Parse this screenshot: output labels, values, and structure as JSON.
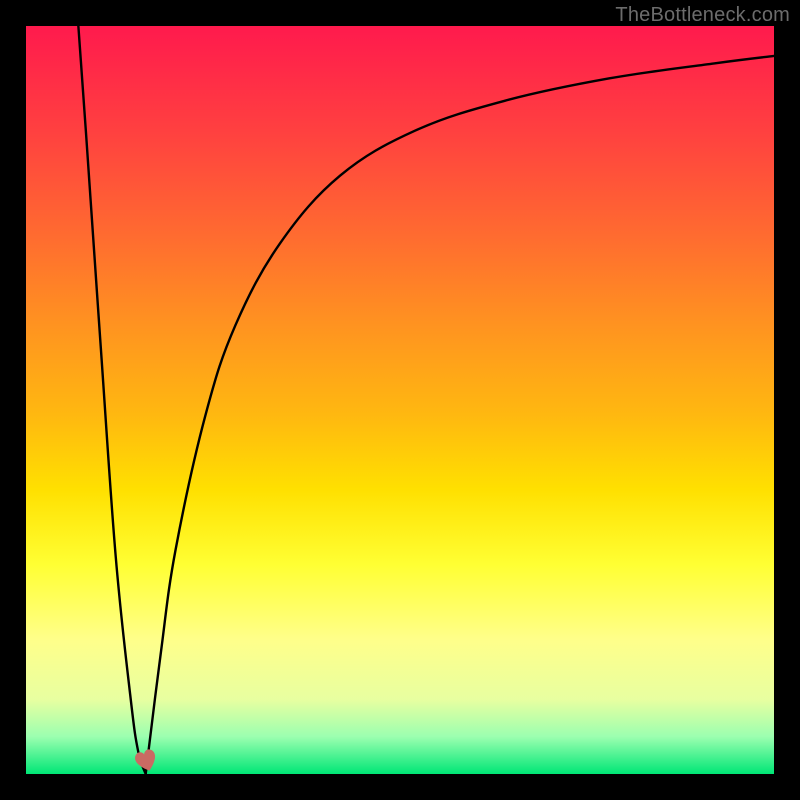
{
  "watermark": "TheBottleneck.com",
  "chart_data": {
    "type": "line",
    "title": "",
    "xlabel": "",
    "ylabel": "",
    "xlim": [
      0,
      100
    ],
    "ylim": [
      0,
      100
    ],
    "legend": false,
    "grid": false,
    "series": [
      {
        "name": "left-branch",
        "x": [
          7,
          8,
          10,
          12,
          14,
          15,
          16
        ],
        "values": [
          100,
          86,
          57,
          29,
          10,
          3,
          0
        ]
      },
      {
        "name": "right-branch",
        "x": [
          16,
          18,
          20,
          24,
          28,
          34,
          42,
          52,
          64,
          78,
          92,
          100
        ],
        "values": [
          0,
          16,
          30,
          48,
          60,
          71,
          80,
          86,
          90,
          93,
          95,
          96
        ]
      }
    ],
    "marker": {
      "name": "heart-marker",
      "x": 16,
      "y": 1.5,
      "display_color": "#c96a63"
    },
    "background": {
      "type": "vertical-gradient",
      "stops": [
        {
          "pos": 0.0,
          "color": "#ff1a4d"
        },
        {
          "pos": 0.62,
          "color": "#ffe000"
        },
        {
          "pos": 0.82,
          "color": "#ffff8a"
        },
        {
          "pos": 1.0,
          "color": "#00e676"
        }
      ]
    }
  }
}
